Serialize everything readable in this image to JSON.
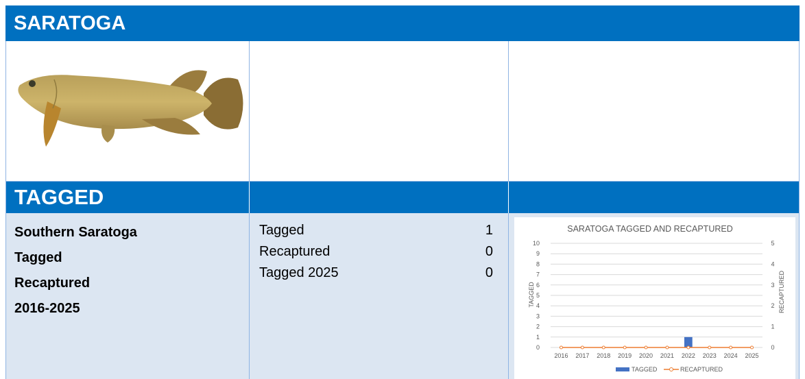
{
  "header": {
    "title": "SARATOGA"
  },
  "image": {
    "alt": "Saratoga fish illustration",
    "body_color": "#c7ad62",
    "fin_color": "#9a7c3e"
  },
  "section": {
    "title": "TAGGED"
  },
  "description": [
    "Southern Saratoga",
    "Tagged",
    "Recaptured",
    "2016-2025"
  ],
  "stats": [
    {
      "label": "Tagged",
      "value": "1"
    },
    {
      "label": "Recaptured",
      "value": "0"
    },
    {
      "label": "Tagged 2025",
      "value": "0"
    }
  ],
  "colors": {
    "header_blue": "#0070c0",
    "panel_blue": "#dce6f2",
    "grid_line": "#8eb4e3"
  },
  "chart_data": {
    "type": "bar",
    "title": "SARATOGA TAGGED AND RECAPTURED",
    "categories": [
      "2016",
      "2017",
      "2018",
      "2019",
      "2020",
      "2021",
      "2022",
      "2023",
      "2024",
      "2025"
    ],
    "series": [
      {
        "name": "TAGGED",
        "type": "bar",
        "axis": "left",
        "color": "#4472c4",
        "values": [
          0,
          0,
          0,
          0,
          0,
          0,
          1,
          0,
          0,
          0
        ]
      },
      {
        "name": "RECAPTURED",
        "type": "line",
        "axis": "right",
        "color": "#ed7d31",
        "values": [
          0,
          0,
          0,
          0,
          0,
          0,
          0,
          0,
          0,
          0
        ]
      }
    ],
    "ylabel": "TAGGED",
    "y2label": "RECAPTURED",
    "ylim": [
      0,
      10
    ],
    "y2lim": [
      0,
      5
    ],
    "yticks": [
      "0",
      "1",
      "2",
      "3",
      "4",
      "5",
      "6",
      "7",
      "8",
      "9",
      "10"
    ],
    "y2ticks": [
      "0",
      "1",
      "2",
      "3",
      "4",
      "5"
    ],
    "grid": true,
    "legend": "bottom"
  }
}
